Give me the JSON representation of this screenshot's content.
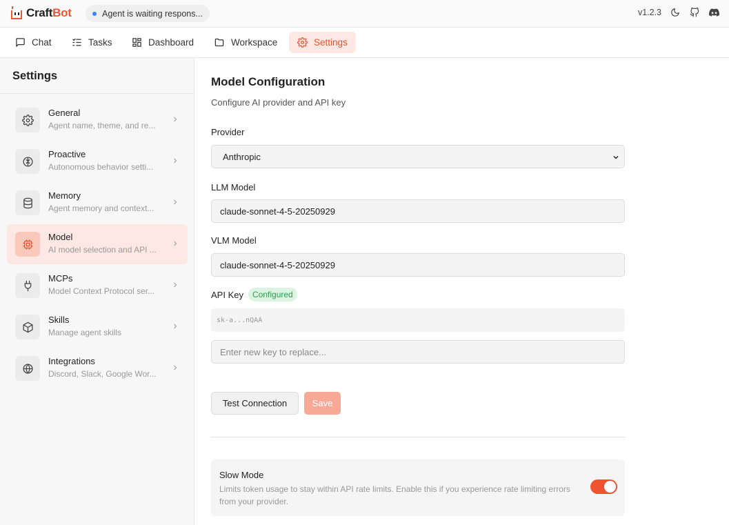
{
  "app": {
    "name_part1": "Craft",
    "name_part2": "Bot",
    "status": "Agent is waiting respons...",
    "version": "v1.2.3"
  },
  "icons": {
    "theme": "moon-icon",
    "github": "github-icon",
    "discord": "discord-icon"
  },
  "colors": {
    "accent": "#f0532f",
    "accent_light": "#fde8e3",
    "success": "#2a9d4b"
  },
  "tabs": [
    {
      "label": "Chat",
      "icon": "chat-icon"
    },
    {
      "label": "Tasks",
      "icon": "tasks-icon"
    },
    {
      "label": "Dashboard",
      "icon": "dashboard-icon"
    },
    {
      "label": "Workspace",
      "icon": "folder-icon"
    },
    {
      "label": "Settings",
      "icon": "gear-icon",
      "active": true
    }
  ],
  "sidebar": {
    "title": "Settings",
    "items": [
      {
        "label": "General",
        "sub": "Agent name, theme, and re...",
        "icon": "gear-icon"
      },
      {
        "label": "Proactive",
        "sub": "Autonomous behavior setti...",
        "icon": "brain-icon"
      },
      {
        "label": "Memory",
        "sub": "Agent memory and context...",
        "icon": "database-icon"
      },
      {
        "label": "Model",
        "sub": "AI model selection and API ...",
        "icon": "cpu-icon",
        "active": true
      },
      {
        "label": "MCPs",
        "sub": "Model Context Protocol ser...",
        "icon": "plug-icon"
      },
      {
        "label": "Skills",
        "sub": "Manage agent skills",
        "icon": "cube-icon"
      },
      {
        "label": "Integrations",
        "sub": "Discord, Slack, Google Wor...",
        "icon": "globe-icon"
      }
    ]
  },
  "main": {
    "title": "Model Configuration",
    "subtitle": "Configure AI provider and API key",
    "provider_label": "Provider",
    "provider_value": "Anthropic",
    "llm_label": "LLM Model",
    "llm_value": "claude-sonnet-4-5-20250929",
    "vlm_label": "VLM Model",
    "vlm_value": "claude-sonnet-4-5-20250929",
    "api_key_label": "API Key",
    "api_key_badge": "Configured",
    "api_key_masked": "sk-a...nQAA",
    "api_key_placeholder": "Enter new key to replace...",
    "test_button": "Test Connection",
    "save_button": "Save",
    "slow_mode": {
      "title": "Slow Mode",
      "description": "Limits token usage to stay within API rate limits. Enable this if you experience rate limiting errors from your provider.",
      "enabled": true
    }
  }
}
